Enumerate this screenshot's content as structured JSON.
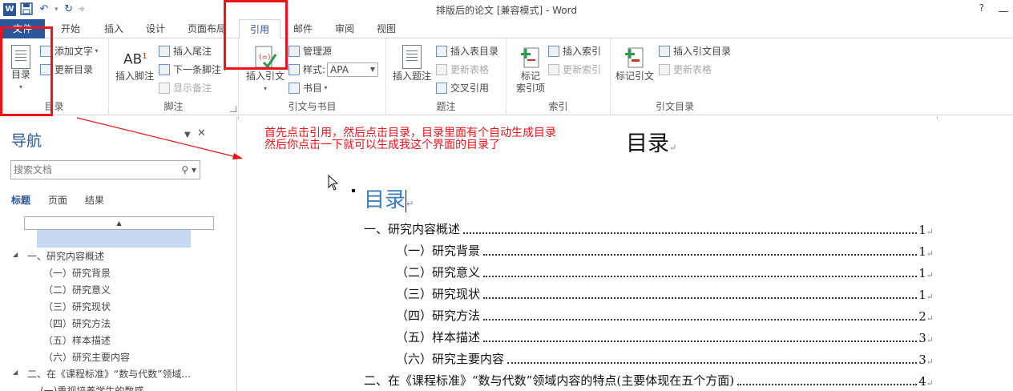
{
  "window": {
    "title": "排版后的论文 [兼容模式] - Word",
    "help": "?",
    "app_icon_letter": "W"
  },
  "tabs": [
    "文件",
    "开始",
    "插入",
    "设计",
    "页面布局",
    "引用",
    "邮件",
    "审阅",
    "视图"
  ],
  "ribbon": {
    "toc_group": {
      "toc_button": "目录",
      "add_text": "添加文字",
      "update_toc": "更新目录",
      "label": "目录"
    },
    "footnote_group": {
      "insert_footnote": "插入脚注",
      "insert_endnote": "插入尾注",
      "next_footnote": "下一条脚注",
      "show_notes": "显示备注",
      "label": "脚注",
      "ab_icon": "AB"
    },
    "citation_group": {
      "insert_citation": "插入引文",
      "manage_sources": "管理源",
      "style_label": "样式:",
      "style_value": "APA",
      "bibliography": "书目",
      "label": "引文与书目"
    },
    "caption_group": {
      "insert_caption": "插入题注",
      "insert_table_of_figures": "插入表目录",
      "update_table": "更新表格",
      "cross_reference": "交叉引用",
      "label": "题注"
    },
    "index_group": {
      "mark_entry_line1": "标记",
      "mark_entry_line2": "索引项",
      "insert_index": "插入索引",
      "update_index": "更新索引",
      "label": "索引"
    },
    "authorities_group": {
      "mark_citation": "标记引文",
      "insert_toa": "插入引文目录",
      "update_table": "更新表格",
      "label": "引文目录"
    }
  },
  "nav": {
    "title": "导航",
    "search_placeholder": "搜索文档",
    "tabs": [
      "标题",
      "页面",
      "结果"
    ],
    "items": [
      {
        "text": "一、研究内容概述",
        "level": 1,
        "expanded": true
      },
      {
        "text": "（一）研究背景",
        "level": 2
      },
      {
        "text": "（二）研究意义",
        "level": 2
      },
      {
        "text": "（三）研究现状",
        "level": 2
      },
      {
        "text": "（四）研究方法",
        "level": 2
      },
      {
        "text": "（五）样本描述",
        "level": 2
      },
      {
        "text": "（六）研究主要内容",
        "level": 2
      },
      {
        "text": "二、在《课程标准》“数与代数”领域...",
        "level": 1,
        "expanded": true
      },
      {
        "text": "(一)重视培养学生的数感",
        "level": 2
      }
    ]
  },
  "document": {
    "note_line1": "首先点击引用，然后点击目录，目录里面有个自动生成目录",
    "note_line2": "然后你点击一下就可以生成我这个界面的目录了",
    "big_title": "目录",
    "toc_heading": "目录",
    "paragraph_mark": "↵",
    "toc": [
      {
        "text": "一、研究内容概述",
        "page": "1",
        "level": 1
      },
      {
        "text": "（一）研究背景",
        "page": "1",
        "level": 2
      },
      {
        "text": "（二）研究意义",
        "page": "1",
        "level": 2
      },
      {
        "text": "（三）研究现状",
        "page": "1",
        "level": 2
      },
      {
        "text": "（四）研究方法",
        "page": "2",
        "level": 2
      },
      {
        "text": "（五）样本描述",
        "page": "3",
        "level": 2
      },
      {
        "text": "（六）研究主要内容",
        "page": "3",
        "level": 2
      },
      {
        "text": "二、在《课程标准》“数与代数”领域内容的特点(主要体现在五个方面)",
        "page": "4",
        "level": 1
      }
    ]
  },
  "colors": {
    "word_blue": "#2b579a",
    "annotation_red": "#e8151b",
    "toc_heading_blue": "#3b7bbf",
    "nav_selection": "#c5d9f1"
  }
}
